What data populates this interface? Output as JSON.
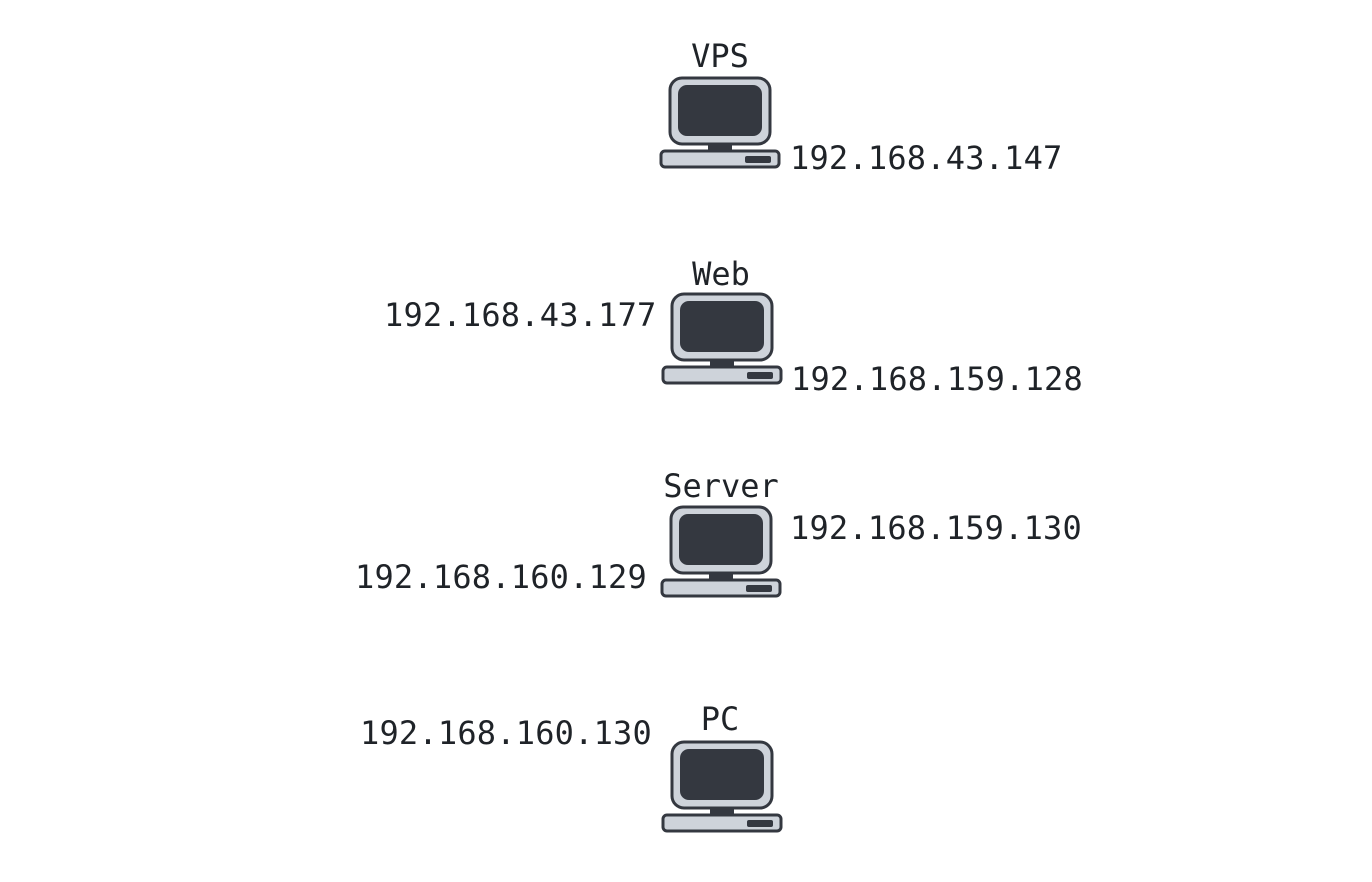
{
  "nodes": [
    {
      "name": "VPS",
      "ips": [
        "192.168.43.147"
      ]
    },
    {
      "name": "Web",
      "ips": [
        "192.168.43.177",
        "192.168.159.128"
      ]
    },
    {
      "name": "Server",
      "ips": [
        "192.168.159.130",
        "192.168.160.129"
      ]
    },
    {
      "name": "PC",
      "ips": [
        "192.168.160.130"
      ]
    }
  ],
  "icon": "computer-icon",
  "colors": {
    "screen": "#343840",
    "body": "#ced3da",
    "outline": "#343840",
    "text": "#1f2328"
  }
}
